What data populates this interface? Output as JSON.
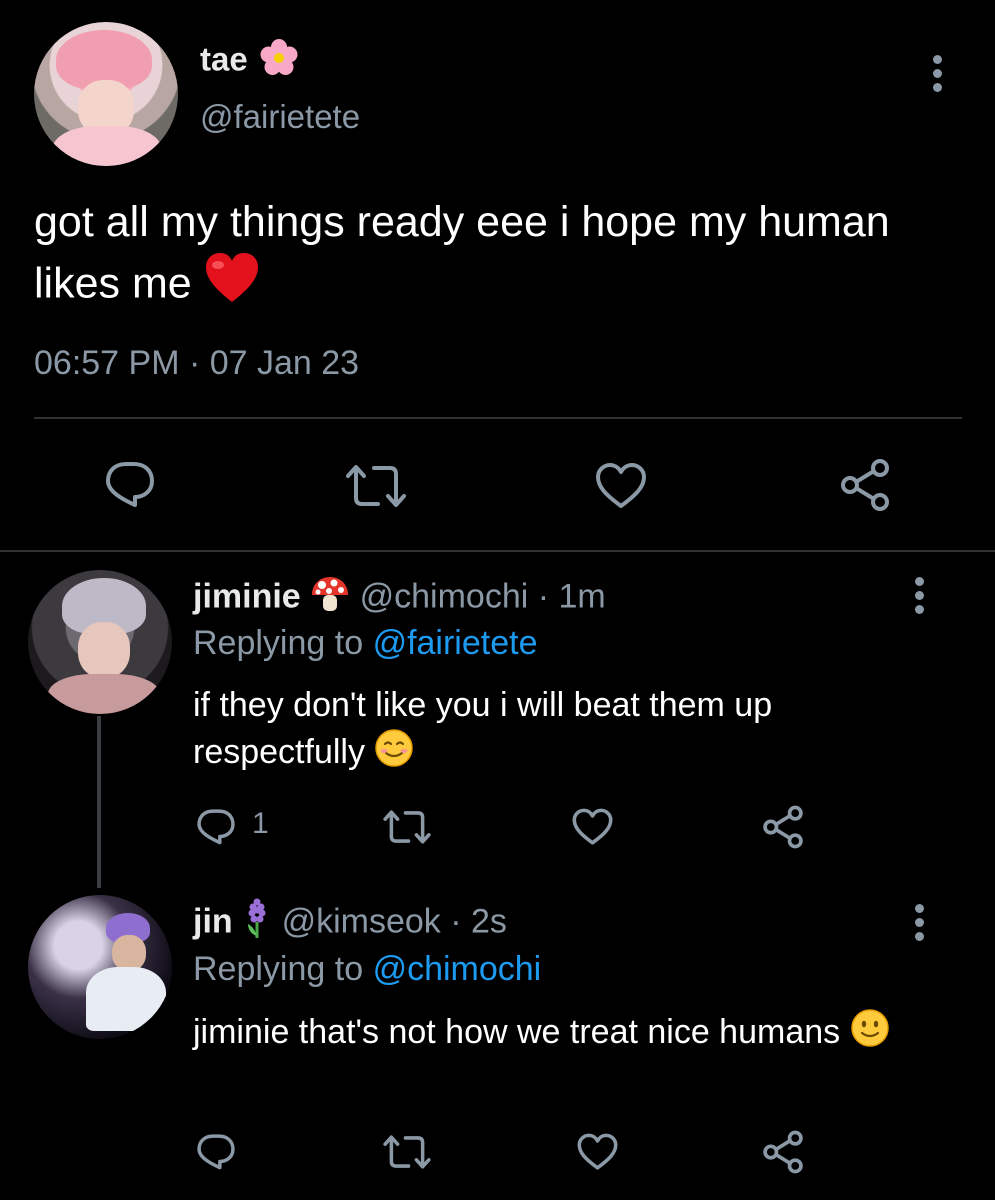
{
  "main_tweet": {
    "author_name": "tae",
    "author_emoji": "cherry-blossom",
    "handle": "@fairietete",
    "text": "got all my things ready eee i hope my human likes me",
    "text_emoji": "red-heart",
    "timestamp": "06:57 PM · 07 Jan 23"
  },
  "replies": [
    {
      "author_name": "jiminie",
      "author_emoji": "mushroom",
      "handle": "@chimochi",
      "time": "· 1m",
      "replying_prefix": "Replying to",
      "replying_to": "@fairietete",
      "text": "if they don't like you i will beat them up respectfully",
      "text_emoji": "smiling-face",
      "reply_count": "1"
    },
    {
      "author_name": "jin",
      "author_emoji": "hyacinth",
      "handle": "@kimseok",
      "time": "· 2s",
      "replying_prefix": "Replying to",
      "replying_to": "@chimochi",
      "text": "jiminie that's not how we treat nice humans",
      "text_emoji": "slightly-smiling-face",
      "reply_count": ""
    }
  ],
  "colors": {
    "background": "#000000",
    "text": "#e7e9ea",
    "muted": "#8b98a5",
    "link": "#1d9bf0"
  }
}
